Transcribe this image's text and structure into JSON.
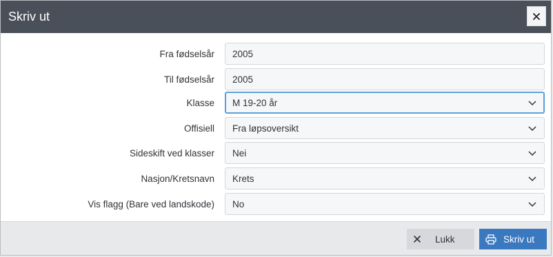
{
  "dialog": {
    "title": "Skriv ut",
    "close_icon": "close-icon"
  },
  "form": {
    "fields": [
      {
        "label": "Fra fødselsår",
        "value": "2005",
        "type": "text"
      },
      {
        "label": "Til fødselsår",
        "value": "2005",
        "type": "text"
      },
      {
        "label": "Klasse",
        "value": "M 19-20 år",
        "type": "select",
        "focused": true
      },
      {
        "label": "Offisiell",
        "value": "Fra løpsoversikt",
        "type": "select"
      },
      {
        "label": "Sideskift ved klasser",
        "value": "Nei",
        "type": "select"
      },
      {
        "label": "Nasjon/Kretsnavn",
        "value": "Krets",
        "type": "select"
      },
      {
        "label": "Vis flagg (Bare ved landskode)",
        "value": "No",
        "type": "select"
      }
    ]
  },
  "footer": {
    "close_label": "Lukk",
    "close_icon": "x-icon",
    "print_label": "Skriv ut",
    "print_icon": "printer-icon"
  },
  "colors": {
    "titlebar": "#4a5059",
    "primary_button": "#3a79bf",
    "focus_border": "#5b9fd8"
  }
}
